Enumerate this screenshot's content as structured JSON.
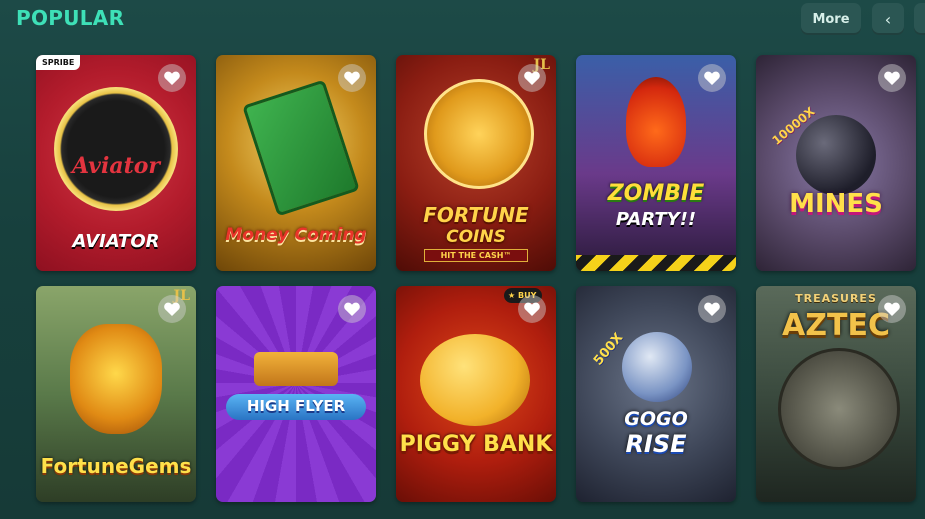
{
  "section": {
    "title": "POPULAR"
  },
  "controls": {
    "more_label": "More",
    "prev_glyph": "‹"
  },
  "games": [
    {
      "name": "AVIATOR",
      "provider_badge": "SPRIBE",
      "logo_text": "Aviator"
    },
    {
      "name": "Money Coming"
    },
    {
      "name": "FORTUNE",
      "name_line2": "COINS",
      "tagline": "HIT THE CASH™",
      "corner_mark": "JL"
    },
    {
      "name": "ZOMBIE",
      "name_line2": "PARTY!!"
    },
    {
      "name": "MINES",
      "multiplier": "10000X"
    },
    {
      "name": "FortuneGems",
      "corner_mark": "JL"
    },
    {
      "name": "HIGH FLYER"
    },
    {
      "name": "PIGGY BANK",
      "buy_badge": "BUY"
    },
    {
      "name": "GOGO",
      "name_line2": "RISE",
      "multiplier": "500X"
    },
    {
      "name": "AZTEC",
      "subtitle": "TREASURES"
    }
  ]
}
